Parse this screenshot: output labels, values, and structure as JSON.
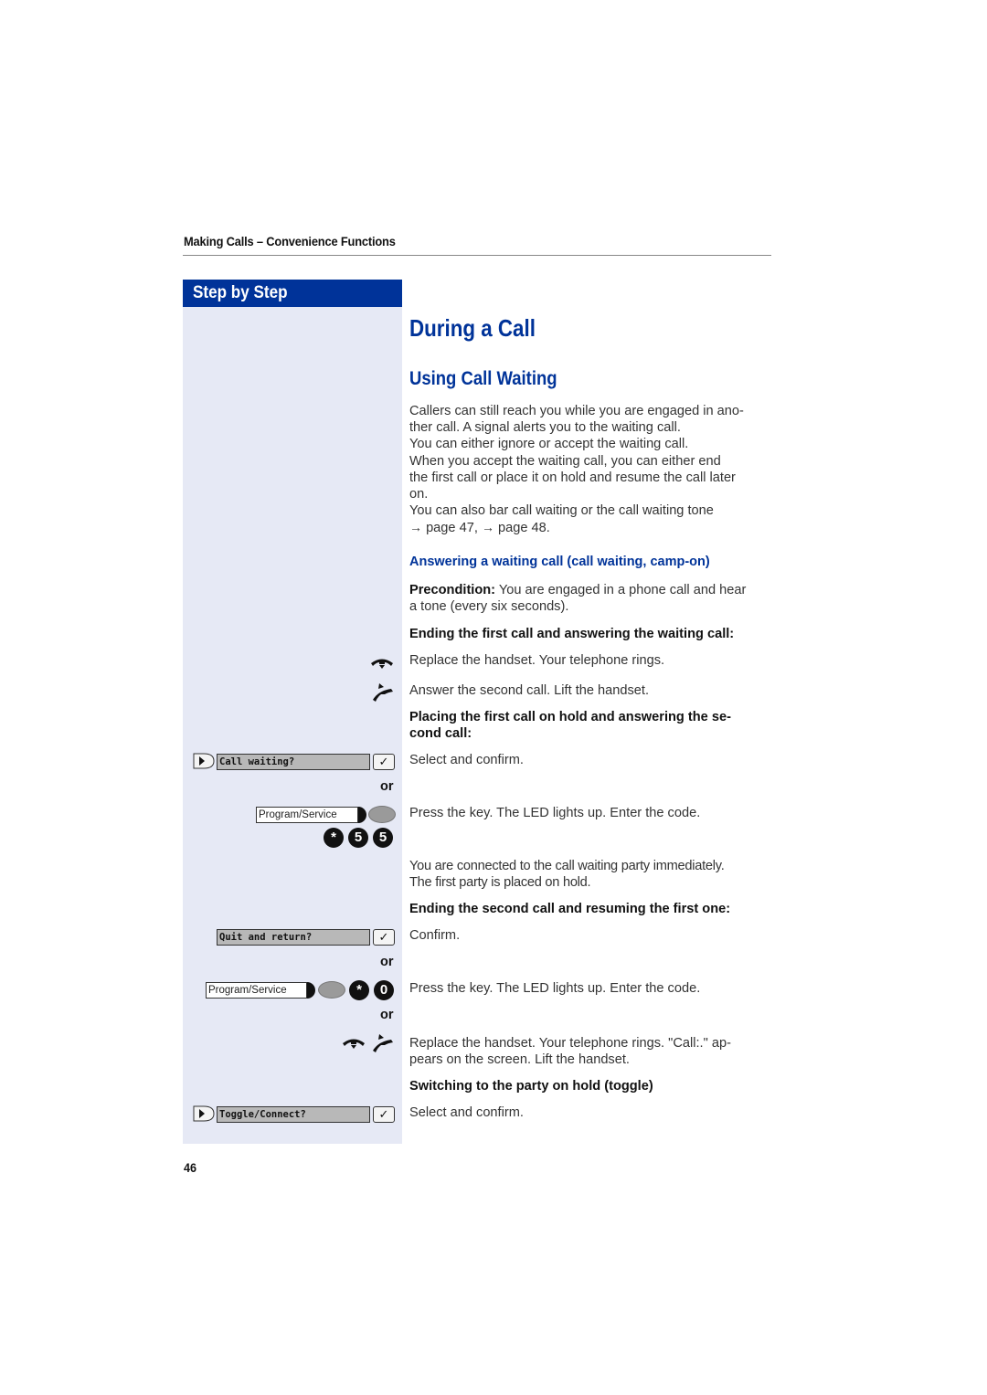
{
  "running_head": "Making Calls – Convenience Functions",
  "sidebar": {
    "header": "Step by Step",
    "displays": {
      "call_waiting": "Call waiting?",
      "quit_and_return": "Quit and return?",
      "toggle_connect": "Toggle/Connect?"
    },
    "keys": {
      "program_service_1": "Program/Service",
      "program_service_2": "Program/Service"
    },
    "codes": {
      "code1": [
        "*",
        "5",
        "5"
      ],
      "code2": [
        "*",
        "0"
      ]
    },
    "or_labels": [
      "or",
      "or",
      "or"
    ],
    "check_symbol": "✓"
  },
  "main": {
    "title": "During a Call",
    "subtitle": "Using Call Waiting",
    "intro": [
      "Callers can still reach you while you are engaged in ano-",
      "ther call. A signal alerts you to the waiting call.",
      "You can either ignore or accept the waiting call.",
      "When you accept the waiting call, you can either end",
      "the first call or place it on hold and resume the call later",
      "on.",
      "You can also bar call waiting or the call waiting tone"
    ],
    "refs": {
      "arrow": "→",
      "ref1": "page 47,",
      "ref2": "page 48."
    },
    "section_heading": "Answering a waiting call (call waiting, camp-on)",
    "precondition_label": "Precondition:",
    "precondition_text_1": " You are engaged in a phone call and hear",
    "precondition_text_2": "a tone (every six seconds).",
    "sub1_heading": "Ending the first call and answering the waiting call:",
    "step_replace": "Replace the handset. Your telephone rings.",
    "step_answer": "Answer the second call. Lift the handset.",
    "sub2_heading_1": "Placing the first call on hold and answering the se-",
    "sub2_heading_2": "cond call:",
    "step_select_confirm_1": "Select and confirm.",
    "step_press_key_1": "Press the key. The LED lights up. Enter the code.",
    "connected_1": "You are connected to the call waiting party immediately.",
    "connected_2": "The first party is placed on hold.",
    "sub3_heading": "Ending the second call and resuming the first one:",
    "step_confirm": "Confirm.",
    "step_press_key_2": "Press the key. The LED lights up. Enter the code.",
    "step_replace_2_line1": "Replace the handset. Your telephone rings. \"Call:.\" ap-",
    "step_replace_2_line2": "pears on the screen. Lift the handset.",
    "sub4_heading": "Switching to the party on hold (toggle)",
    "step_select_confirm_2": "Select and confirm."
  },
  "page_number": "46"
}
